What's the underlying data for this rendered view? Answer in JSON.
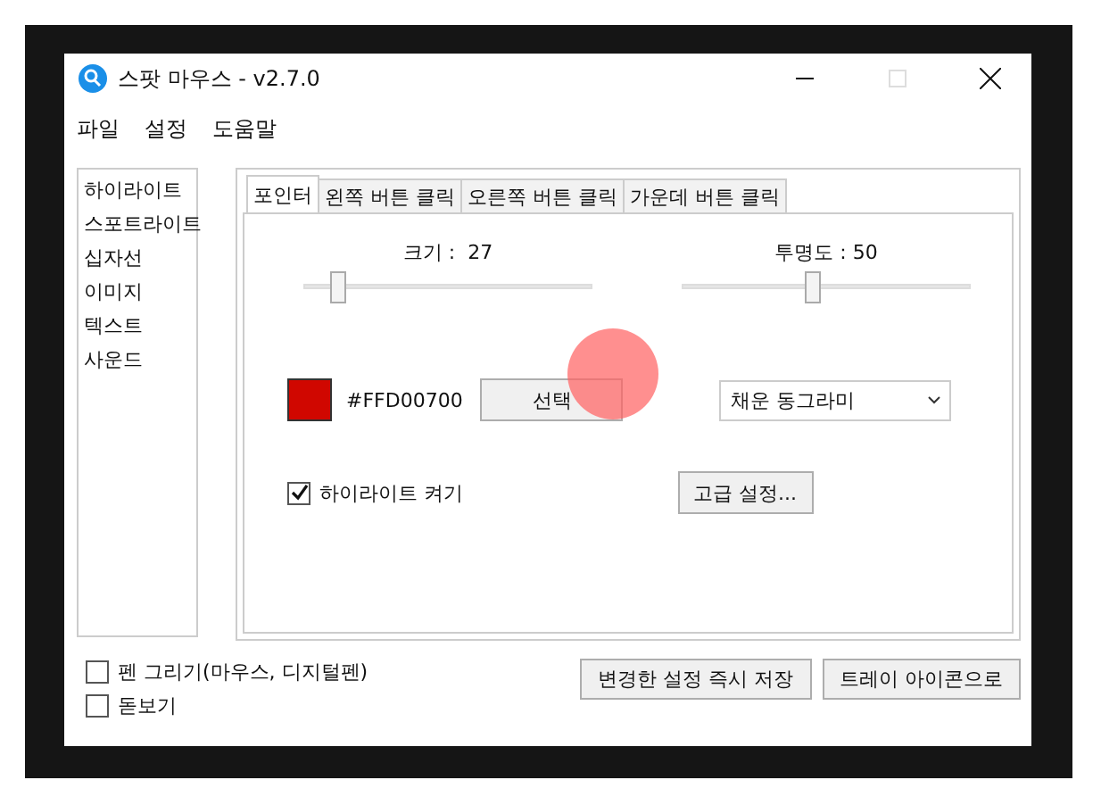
{
  "window": {
    "title": "스팟 마우스 - v2.7.0"
  },
  "menu": [
    "파일",
    "설정",
    "도움말"
  ],
  "sidebar": {
    "items": [
      "하이라이트",
      "스포트라이트",
      "십자선",
      "이미지",
      "텍스트",
      "사운드"
    ]
  },
  "tabs": [
    {
      "label": "포인터",
      "selected": true
    },
    {
      "label": "왼쪽 버튼 클릭",
      "selected": false
    },
    {
      "label": "오른쪽 버튼 클릭",
      "selected": false
    },
    {
      "label": "가운데 버튼 클릭",
      "selected": false
    }
  ],
  "size": {
    "label": "크기 :  27",
    "level": 0.1
  },
  "opacity": {
    "label": "투명도 : 50",
    "level": 0.45
  },
  "color": {
    "code": "#FFD00700",
    "button": "선택"
  },
  "shape": {
    "value": "채운 동그라미"
  },
  "advanced_button": "고급 설정...",
  "highlight_on": {
    "label": "하이라이트 켜기",
    "checked": true
  },
  "options": [
    {
      "label": "펜 그리기(마우스, 디지털펜)",
      "checked": false
    },
    {
      "label": "돋보기",
      "checked": false
    }
  ],
  "buttons": [
    "변경한 설정 즉시 저장",
    "트레이 아이콘으로"
  ]
}
